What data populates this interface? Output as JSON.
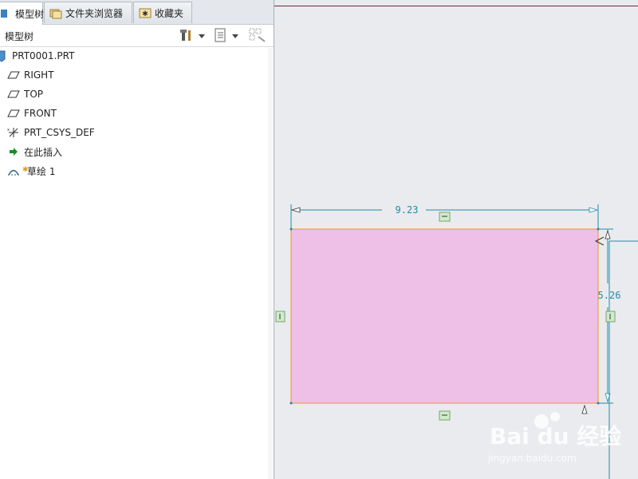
{
  "tabs": [
    {
      "label": "模型树",
      "icon": "model-tree-icon",
      "active": true
    },
    {
      "label": "文件夹浏览器",
      "icon": "folder-browser-icon",
      "active": false
    },
    {
      "label": "收藏夹",
      "icon": "favorites-icon",
      "active": false
    }
  ],
  "toolbar": {
    "title": "模型树",
    "settings_icon": "tools-icon",
    "show_icon": "list-icon",
    "filter_icon": "filter-icon"
  },
  "tree": {
    "root": "PRT0001.PRT",
    "items": [
      {
        "label": "RIGHT",
        "icon": "datum-plane-icon"
      },
      {
        "label": "TOP",
        "icon": "datum-plane-icon"
      },
      {
        "label": "FRONT",
        "icon": "datum-plane-icon"
      },
      {
        "label": "PRT_CSYS_DEF",
        "icon": "csys-icon"
      },
      {
        "label": "在此插入",
        "icon": "insert-here-arrow-icon"
      },
      {
        "label": "草绘 1",
        "icon": "sketch-icon"
      }
    ]
  },
  "sketch": {
    "width_dim": "9.23",
    "height_dim": "5.26",
    "fill_color": "#eec0e8",
    "edge_color": "#f0a040",
    "dim_color": "#1f8ea8"
  },
  "annotation": {
    "arrow_color": "#e01010"
  },
  "watermark": {
    "logo": "Bai du 经验",
    "url": "jingyan.baidu.com"
  }
}
